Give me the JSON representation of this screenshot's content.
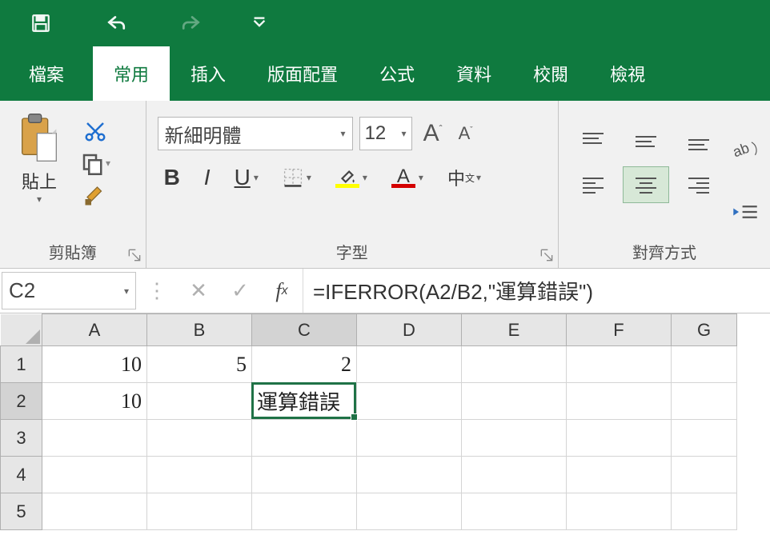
{
  "qat": {},
  "tabs": {
    "file": "檔案",
    "home": "常用",
    "insert": "插入",
    "layout": "版面配置",
    "formulas": "公式",
    "data": "資料",
    "review": "校閱",
    "view": "檢視"
  },
  "ribbon": {
    "clipboard": {
      "paste": "貼上",
      "group": "剪貼簿"
    },
    "font": {
      "name": "新細明體",
      "size": "12",
      "group": "字型",
      "phonetic": "中"
    },
    "align": {
      "group": "對齊方式"
    }
  },
  "formula_bar": {
    "namebox": "C2",
    "formula": "=IFERROR(A2/B2,\"運算錯誤\")"
  },
  "grid": {
    "cols": [
      "A",
      "B",
      "C",
      "D",
      "E",
      "F",
      "G"
    ],
    "rows": [
      "1",
      "2",
      "3",
      "4",
      "5"
    ],
    "cells": {
      "A1": "10",
      "B1": "5",
      "C1": "2",
      "A2": "10",
      "C2": "運算錯誤"
    },
    "active": "C2"
  }
}
